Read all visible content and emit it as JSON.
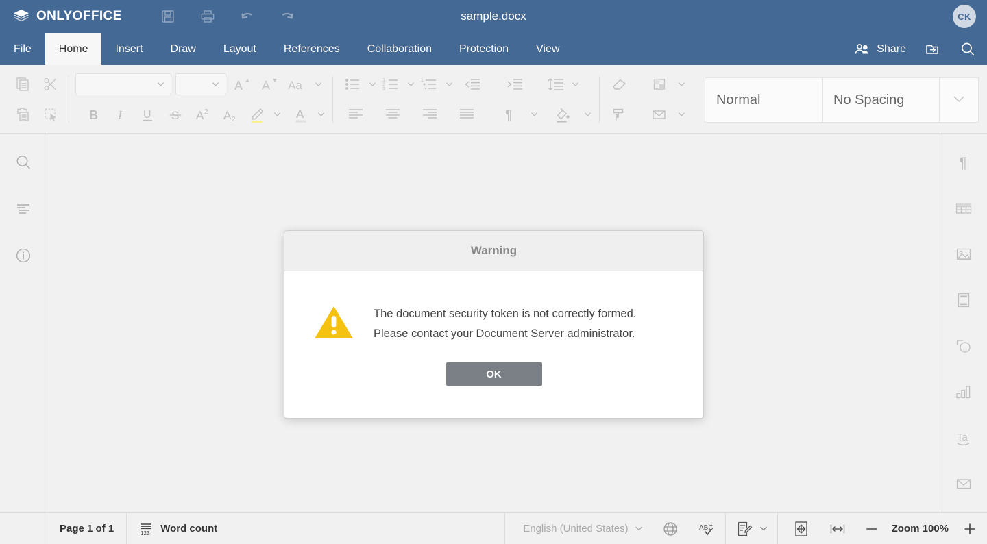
{
  "titlebar": {
    "brand": "ONLYOFFICE",
    "document_title": "sample.docx",
    "avatar_initials": "CK",
    "quick_access": [
      {
        "name": "save-icon",
        "label": "Save"
      },
      {
        "name": "print-icon",
        "label": "Print"
      },
      {
        "name": "undo-icon",
        "label": "Undo"
      },
      {
        "name": "redo-icon",
        "label": "Redo"
      }
    ]
  },
  "tabs": [
    {
      "label": "File",
      "active": false
    },
    {
      "label": "Home",
      "active": true
    },
    {
      "label": "Insert",
      "active": false
    },
    {
      "label": "Draw",
      "active": false
    },
    {
      "label": "Layout",
      "active": false
    },
    {
      "label": "References",
      "active": false
    },
    {
      "label": "Collaboration",
      "active": false
    },
    {
      "label": "Protection",
      "active": false
    },
    {
      "label": "View",
      "active": false
    }
  ],
  "tabbar_right": {
    "share_label": "Share",
    "open_location_icon": "open-file-location-icon",
    "search_icon": "search-icon"
  },
  "ribbon": {
    "font_name_value": "",
    "font_name_placeholder": "",
    "font_size_value": "",
    "font_size_placeholder": "",
    "clipboard": [
      "copy-icon",
      "cut-icon",
      "paste-icon",
      "select-all-icon"
    ],
    "font_tools": [
      "increase-font-size-icon",
      "decrease-font-size-icon",
      "change-case-icon",
      "bold-icon",
      "italic-icon",
      "underline-icon",
      "strikethrough-icon",
      "superscript-icon",
      "subscript-icon",
      "highlight-color-icon",
      "font-color-icon"
    ],
    "paragraph_tools": [
      "bullets-icon",
      "numbering-icon",
      "multilevel-list-icon",
      "decrease-indent-icon",
      "increase-indent-icon",
      "line-spacing-icon",
      "align-left-icon",
      "align-center-icon",
      "align-right-icon",
      "justify-icon",
      "show-formatting-marks-icon",
      "shading-icon"
    ],
    "extra_tools": [
      "clear-style-icon",
      "borders-icon",
      "format-painter-icon",
      "mail-merge-icon"
    ],
    "styles": [
      {
        "label": "Normal"
      },
      {
        "label": "No Spacing"
      }
    ],
    "styles_more_icon": "chevron-down-icon",
    "highlight_color": "#fbf08d",
    "font_color": "#e0e0e0"
  },
  "left_rail": [
    {
      "name": "sidebar-search-icon",
      "label": "Find and Replace"
    },
    {
      "name": "sidebar-headings-icon",
      "label": "Headings"
    },
    {
      "name": "sidebar-about-icon",
      "label": "About"
    }
  ],
  "right_rail": [
    {
      "name": "paragraph-settings-icon",
      "label": "Paragraph settings"
    },
    {
      "name": "table-settings-icon",
      "label": "Table settings"
    },
    {
      "name": "image-settings-icon",
      "label": "Image settings"
    },
    {
      "name": "header-footer-settings-icon",
      "label": "Header and footer settings"
    },
    {
      "name": "shape-settings-icon",
      "label": "Shape settings"
    },
    {
      "name": "chart-settings-icon",
      "label": "Chart settings"
    },
    {
      "name": "text-art-settings-icon",
      "label": "Text Art settings"
    },
    {
      "name": "mail-merge-settings-icon",
      "label": "Mail Merge settings"
    }
  ],
  "statusbar": {
    "page_label": "Page 1 of 1",
    "word_count_label": "Word count",
    "language": "English (United States)",
    "spellcheck_icon": "spellcheck-abc-icon",
    "globe_icon": "set-language-globe-icon",
    "track_changes_icon": "track-changes-icon",
    "fit_page_icon": "fit-to-page-icon",
    "fit_width_icon": "fit-to-width-icon",
    "zoom_out_label": "—",
    "zoom_label": "Zoom 100%",
    "zoom_in_label": "+"
  },
  "dialog": {
    "title": "Warning",
    "icon": "warning-triangle-icon",
    "message_line1": "The document security token is not correctly formed.",
    "message_line2": "Please contact your Document Server administrator.",
    "ok_label": "OK",
    "warning_color": "#f5c211",
    "button_color": "#7b8087"
  },
  "colors": {
    "header_blue": "#446995",
    "toolbar_bg": "#f1f1f1",
    "active_tab_bg": "#f7f7f7"
  }
}
